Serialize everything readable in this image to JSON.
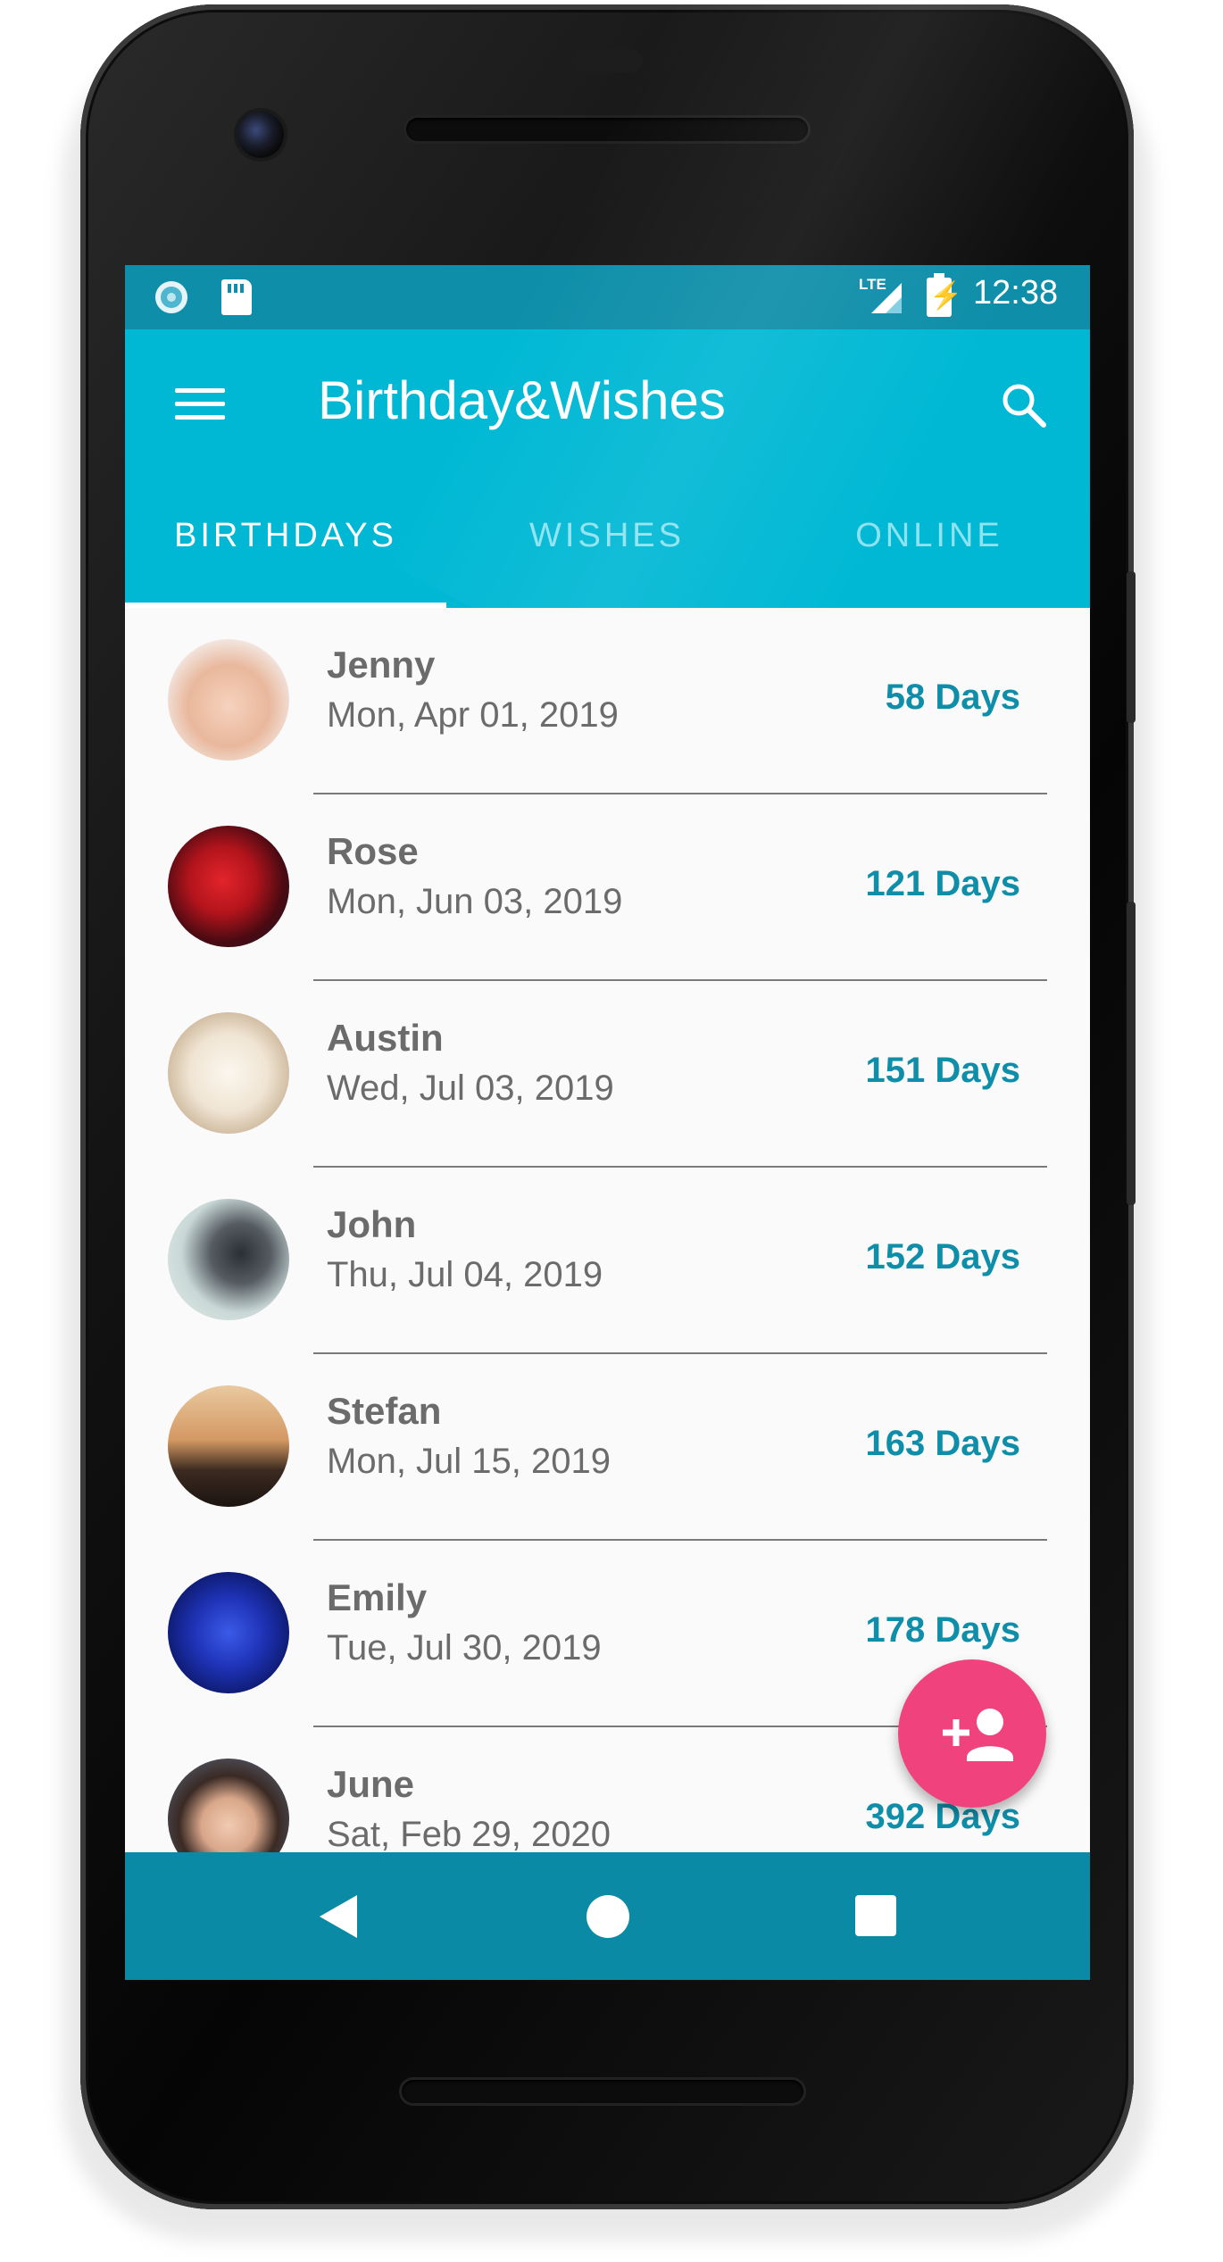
{
  "status_bar": {
    "time": "12:38",
    "network": "LTE"
  },
  "app_bar": {
    "title": "Birthday&Wishes"
  },
  "tabs": [
    {
      "label": "BIRTHDAYS",
      "active": true
    },
    {
      "label": "WISHES",
      "active": false
    },
    {
      "label": "ONLINE",
      "active": false
    }
  ],
  "birthdays": [
    {
      "name": "Jenny",
      "date": "Mon, Apr 01, 2019",
      "days": "58 Days"
    },
    {
      "name": "Rose",
      "date": "Mon, Jun 03, 2019",
      "days": "121 Days"
    },
    {
      "name": "Austin",
      "date": "Wed, Jul 03, 2019",
      "days": "151 Days"
    },
    {
      "name": "John",
      "date": "Thu, Jul 04, 2019",
      "days": "152 Days"
    },
    {
      "name": "Stefan",
      "date": "Mon, Jul 15, 2019",
      "days": "163 Days"
    },
    {
      "name": "Emily",
      "date": "Tue, Jul 30, 2019",
      "days": "178 Days"
    },
    {
      "name": "June",
      "date": "Sat, Feb 29, 2020",
      "days": "392 Days"
    }
  ],
  "icons": {
    "menu": "hamburger-icon",
    "search": "search-icon",
    "fab": "add-person-icon",
    "nav": [
      "back-icon",
      "home-icon",
      "recents-icon"
    ]
  },
  "colors": {
    "primary": "#00b8d4",
    "primary_dark": "#0e8ea9",
    "accent": "#f0437e",
    "days_text": "#0e8ea9"
  }
}
